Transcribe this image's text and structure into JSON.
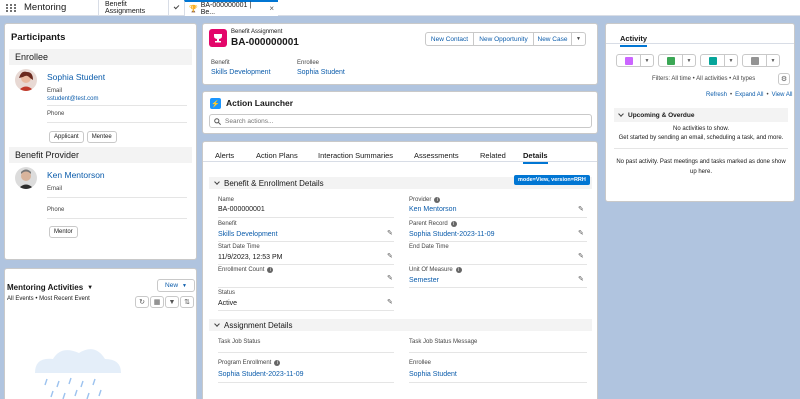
{
  "nav": {
    "app_name": "Mentoring",
    "tabs": [
      {
        "label": "Benefit Assignments"
      },
      {
        "label": "BA-000000001 | Be..."
      }
    ]
  },
  "participants": {
    "title": "Participants",
    "enrollee_section": "Enrollee",
    "enrollee": {
      "name": "Sophia Student",
      "email_label": "Email",
      "email": "sstudent@test.com",
      "phone_label": "Phone",
      "tags": [
        "Applicant",
        "Mentee"
      ]
    },
    "provider_section": "Benefit Provider",
    "provider": {
      "name": "Ken Mentorson",
      "email_label": "Email",
      "phone_label": "Phone",
      "tags": [
        "Mentor"
      ]
    }
  },
  "activities_card": {
    "title": "Mentoring Activities",
    "subtitle": "All Events • Most Recent Event",
    "new_label": "New"
  },
  "record": {
    "object_label": "Benefit Assignment",
    "name": "BA-000000001",
    "actions": [
      "New Contact",
      "New Opportunity",
      "New Case"
    ],
    "benefit_label": "Benefit",
    "benefit_value": "Skills Development",
    "enrollee_label": "Enrollee",
    "enrollee_value": "Sophia Student"
  },
  "launcher": {
    "title": "Action Launcher",
    "search_placeholder": "Search actions..."
  },
  "detail_tabs": [
    "Alerts",
    "Action Plans",
    "Interaction Summaries",
    "Assessments",
    "Related",
    "Details"
  ],
  "details": {
    "section1": "Benefit & Enrollment Details",
    "mode_badge": "mode=View, version=RRH",
    "name_label": "Name",
    "name_value": "BA-000000001",
    "provider_label": "Provider",
    "provider_value": "Ken Mentorson",
    "benefit_label": "Benefit",
    "benefit_value": "Skills Development",
    "parent_label": "Parent Record",
    "parent_value": "Sophia Student-2023-11-09",
    "start_label": "Start Date Time",
    "start_value": "11/9/2023, 12:53 PM",
    "end_label": "End Date Time",
    "enroll_count_label": "Enrollment Count",
    "uom_label": "Unit Of Measure",
    "uom_value": "Semester",
    "status_label": "Status",
    "status_value": "Active",
    "section2": "Assignment Details",
    "task_status_label": "Task Job Status",
    "task_msg_label": "Task Job Status Message",
    "program_label": "Program Enrollment",
    "program_value": "Sophia Student-2023-11-09",
    "enrollee_label": "Enrollee",
    "enrollee_value": "Sophia Student"
  },
  "activity_panel": {
    "tab": "Activity",
    "filters": "Filters: All time • All activities • All types",
    "refresh": "Refresh",
    "expand_all": "Expand All",
    "view_all": "View All",
    "upcoming_title": "Upcoming & Overdue",
    "no_activities": "No activities to show.",
    "get_started": "Get started by sending an email, scheduling a task, and more.",
    "no_past": "No past activity. Past meetings and tasks marked as done show up here."
  },
  "colors": {
    "accent": "#0176d3",
    "link": "#0b5cab",
    "record_icon": "#e3066a",
    "launcher_icon": "#1b96ff",
    "badge": "#0176d3"
  }
}
